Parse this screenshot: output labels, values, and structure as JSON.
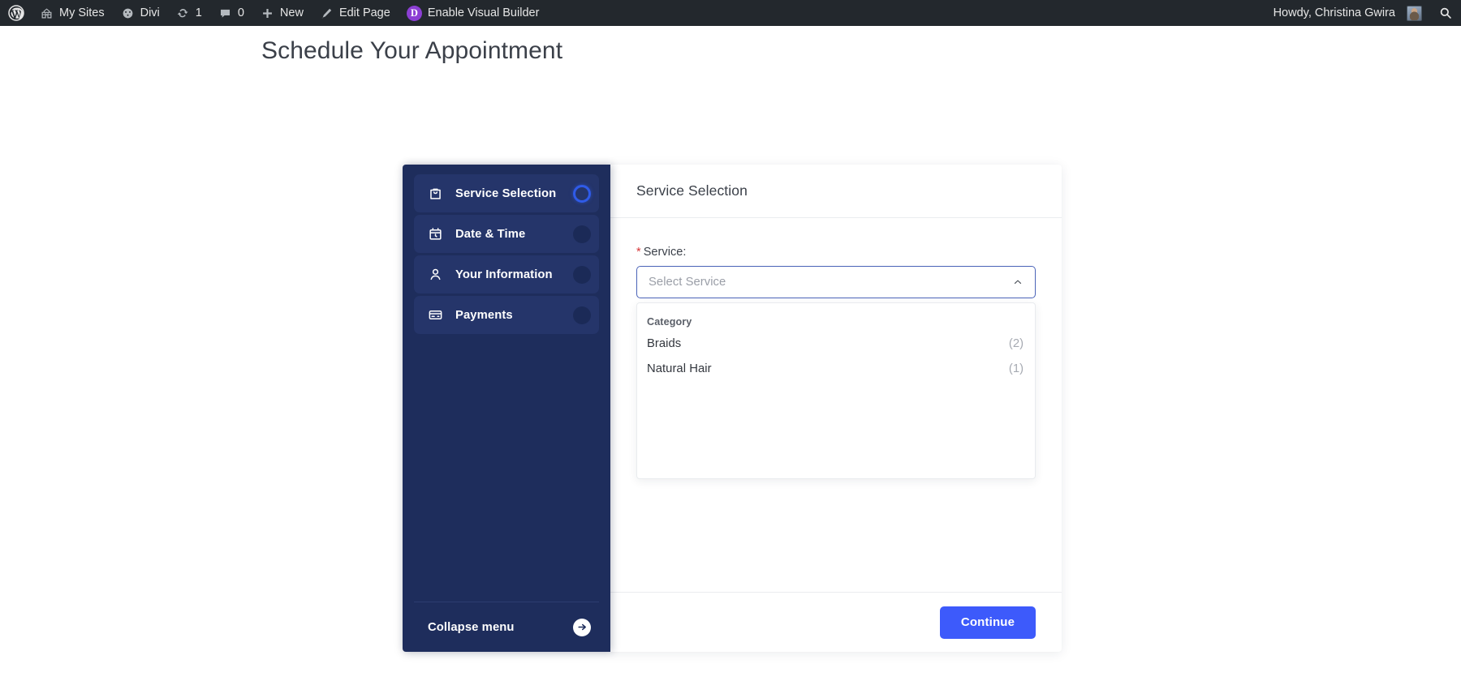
{
  "adminbar": {
    "logo_icon": "wordpress-logo-icon",
    "left_items": [
      {
        "icon": "network-sites-icon",
        "label": "My Sites"
      },
      {
        "icon": "divi-speedometer-icon",
        "label": "Divi"
      },
      {
        "icon": "updates-refresh-icon",
        "label": "1"
      },
      {
        "icon": "comment-bubble-icon",
        "label": "0"
      },
      {
        "icon": "plus-icon",
        "label": "New"
      },
      {
        "icon": "pencil-icon",
        "label": "Edit Page"
      },
      {
        "icon": "divi-badge-icon",
        "label": "Enable Visual Builder",
        "badge": "D"
      }
    ],
    "greeting": "Howdy, Christina Gwira",
    "avatar_icon": "user-avatar",
    "search_icon": "search-icon"
  },
  "page": {
    "title": "Schedule Your Appointment"
  },
  "booking": {
    "sidebar": {
      "steps": [
        {
          "icon": "shopping-bag-icon",
          "label": "Service Selection",
          "state": "active"
        },
        {
          "icon": "calendar-clock-icon",
          "label": "Date & Time",
          "state": "inactive"
        },
        {
          "icon": "person-icon",
          "label": "Your Information",
          "state": "inactive"
        },
        {
          "icon": "credit-card-icon",
          "label": "Payments",
          "state": "inactive"
        }
      ],
      "collapse": {
        "label": "Collapse menu",
        "icon": "arrow-right-circle-icon"
      }
    },
    "panel": {
      "header_title": "Service Selection",
      "field": {
        "required_marker": "*",
        "label": "Service:",
        "placeholder": "Select Service",
        "value": "",
        "caret_icon": "chevron-up-icon",
        "expanded": true
      },
      "dropdown": {
        "group_header": "Category",
        "options": [
          {
            "name": "Braids",
            "count": "(2)"
          },
          {
            "name": "Natural Hair",
            "count": "(1)"
          }
        ]
      },
      "footer": {
        "continue_label": "Continue"
      }
    }
  },
  "colors": {
    "adminbar_bg": "#23282d",
    "sidebar_bg": "#1e2d5c",
    "step_bg": "#25356a",
    "active_ring": "#2f5be8",
    "primary_button": "#3d5afb",
    "required_red": "#d63638",
    "divi_purple": "#8c3fd4",
    "input_border": "#4a63b8",
    "page_bg": "#ffffff"
  }
}
